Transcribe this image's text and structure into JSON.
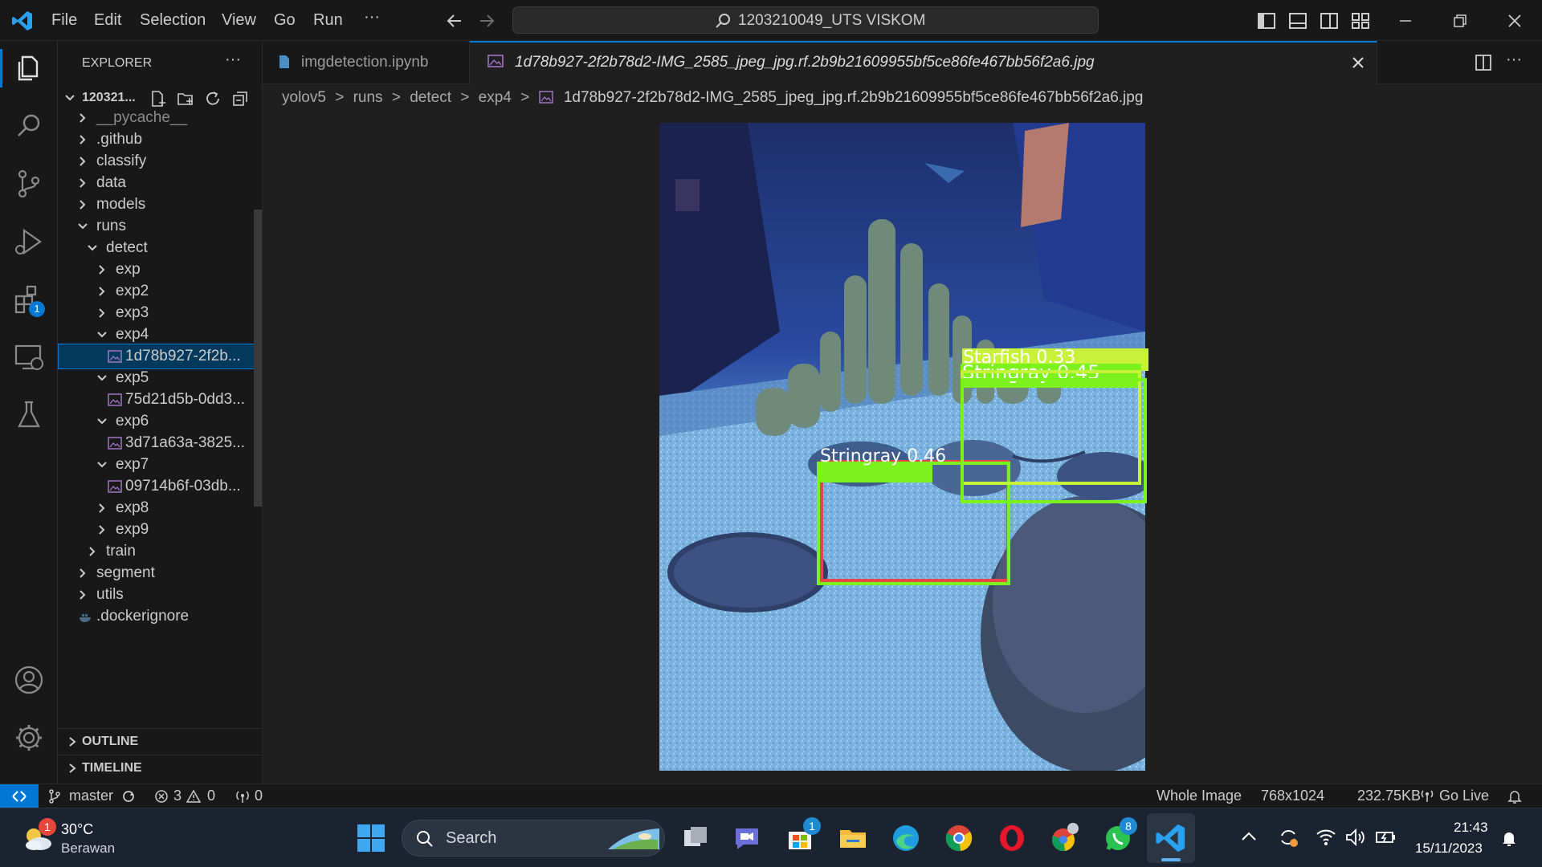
{
  "titlebar": {
    "menus": [
      "File",
      "Edit",
      "Selection",
      "View",
      "Go",
      "Run"
    ],
    "more": "···",
    "search_text": "1203210049_UTS VISKOM"
  },
  "explorer": {
    "title": "EXPLORER",
    "more": "···",
    "root": "120321...",
    "items": [
      {
        "label": "__pycache__",
        "depth": 1,
        "state": "closed"
      },
      {
        "label": ".github",
        "depth": 1,
        "state": "closed"
      },
      {
        "label": "classify",
        "depth": 1,
        "state": "closed"
      },
      {
        "label": "data",
        "depth": 1,
        "state": "closed"
      },
      {
        "label": "models",
        "depth": 1,
        "state": "closed"
      },
      {
        "label": "runs",
        "depth": 1,
        "state": "open"
      },
      {
        "label": "detect",
        "depth": 2,
        "state": "open"
      },
      {
        "label": "exp",
        "depth": 3,
        "state": "closed"
      },
      {
        "label": "exp2",
        "depth": 3,
        "state": "closed"
      },
      {
        "label": "exp3",
        "depth": 3,
        "state": "closed"
      },
      {
        "label": "exp4",
        "depth": 3,
        "state": "open"
      },
      {
        "label": "1d78b927-2f2b...",
        "depth": 4,
        "state": "file",
        "selected": true
      },
      {
        "label": "exp5",
        "depth": 3,
        "state": "open"
      },
      {
        "label": "75d21d5b-0dd3...",
        "depth": 4,
        "state": "file"
      },
      {
        "label": "exp6",
        "depth": 3,
        "state": "open"
      },
      {
        "label": "3d71a63a-3825...",
        "depth": 4,
        "state": "file"
      },
      {
        "label": "exp7",
        "depth": 3,
        "state": "open"
      },
      {
        "label": "09714b6f-03db...",
        "depth": 4,
        "state": "file"
      },
      {
        "label": "exp8",
        "depth": 3,
        "state": "closed"
      },
      {
        "label": "exp9",
        "depth": 3,
        "state": "closed"
      },
      {
        "label": "train",
        "depth": 2,
        "state": "closed"
      },
      {
        "label": "segment",
        "depth": 1,
        "state": "closed"
      },
      {
        "label": "utils",
        "depth": 1,
        "state": "closed"
      },
      {
        "label": ".dockerignore",
        "depth": 1,
        "state": "plainfile"
      }
    ],
    "outline": "OUTLINE",
    "timeline": "TIMELINE"
  },
  "activity": {
    "extensions_badge": "1"
  },
  "tabs": [
    {
      "label": "imgdetection.ipynb",
      "active": false
    },
    {
      "label": "1d78b927-2f2b78d2-IMG_2585_jpeg_jpg.rf.2b9b21609955bf5ce86fe467bb56f2a6.jpg",
      "active": true
    }
  ],
  "breadcrumb": {
    "parts": [
      "yolov5",
      "runs",
      "detect",
      "exp4"
    ],
    "file": "1d78b927-2f2b78d2-IMG_2585_jpeg_jpg.rf.2b9b21609955bf5ce86fe467bb56f2a6.jpg"
  },
  "detections": [
    {
      "label": "Stringray 0.46",
      "color": "#7bf21c"
    },
    {
      "label": "Stringray 0.45",
      "color": "#7bf21c"
    },
    {
      "label": "Starfish 0.33",
      "color": "#c8f23a"
    }
  ],
  "statusbar": {
    "branch": "master",
    "errors": "3",
    "warnings": "0",
    "ports": "0",
    "zoom": "Whole Image",
    "dimensions": "768x1024",
    "size": "232.75KB",
    "golive": "Go Live"
  },
  "taskbar": {
    "weather_temp": "30°C",
    "weather_desc": "Berawan",
    "weather_badge": "1",
    "search": "Search",
    "store_badge": "1",
    "whatsapp_badge": "8",
    "time": "21:43",
    "date": "15/11/2023"
  },
  "colors": {
    "accent": "#0078d4",
    "selection": "#04395e"
  }
}
